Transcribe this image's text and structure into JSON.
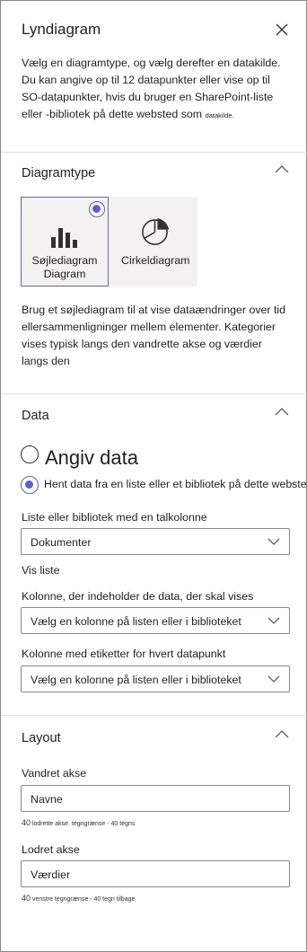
{
  "panel": {
    "title": "Lyndiagram",
    "intro_main": "Vælg en diagramtype, og vælg derefter en datakilde. Du kan angive op til 12 datapunkter eller vise op til SO-datapunkter, hvis du bruger en SharePoint-liste eller -bibliotek på dette websted som",
    "intro_tail": "datakilde."
  },
  "chart_type": {
    "section_title": "Diagramtype",
    "options": [
      {
        "line1": "Søjlediagram",
        "line2": "Diagram",
        "icon": "bar-chart-icon",
        "selected": true
      },
      {
        "line1": "Cirkeldiagram",
        "line2": "",
        "icon": "pie-chart-icon",
        "selected": false
      }
    ],
    "description": "Brug et søjlediagram til at vise dataændringer over tid ellersammenligninger mellem elementer. Kategorier vises typisk langs den vandrette akse og værdier langs den"
  },
  "data": {
    "section_title": "Data",
    "option_manual": "Angiv data",
    "option_list": "Hent data fra en liste eller et bibliotek på dette websted",
    "list_label": "Liste eller bibliotek med en talkolonne",
    "list_value": "Dokumenter",
    "show_list_label": "Vis liste",
    "column_label": "Kolonne, der indeholder de data, der skal vises",
    "column_value": "Vælg en kolonne på listen eller i biblioteket",
    "labels_label": "Kolonne med etiketter for hvert datapunkt",
    "labels_value": "Vælg en kolonne på listen eller i biblioteket"
  },
  "layout": {
    "section_title": "Layout",
    "x_axis_label": "Vandret akse",
    "x_axis_value": "Navne",
    "x_helper_num": "40",
    "x_helper_text": "lodrette akse. tegngrænse - 40 tegns",
    "y_axis_label": "Lodret akse",
    "y_axis_value": "Værdier",
    "y_helper_num": "40",
    "y_helper_text": "venstre tegngrænse - 40 tegn tilbage"
  },
  "colors": {
    "accent": "#5b5fc7",
    "border": "#8a8886",
    "divider": "#e1dfdd",
    "tile_bg": "#f3f2f1"
  }
}
